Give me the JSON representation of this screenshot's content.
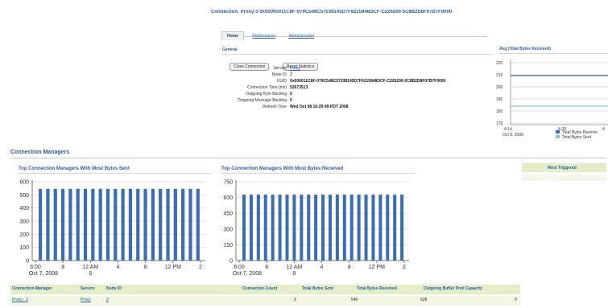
{
  "header": {
    "connection_title": "Connection: Proxy:3 0x00000011C8F-079C5d8C57038145D7F6215848DCF-C226200-5C8B2D8F07B7F0000"
  },
  "tabs": [
    {
      "label": "Home"
    },
    {
      "label": "Performance"
    },
    {
      "label": "Administration"
    }
  ],
  "general": {
    "section_title": "General",
    "close_button": "Close Connection",
    "reset_button": "Reset Statistics",
    "fields": [
      {
        "label": "Service",
        "value": "Proxy"
      },
      {
        "label": "Node ID",
        "value": "2"
      },
      {
        "label": "UUID",
        "value": "0x000011C8F-079C5d8C57038145D7F6215848DCF-C226200-5C8B2D8F07B7F0000"
      },
      {
        "label": "Connection Time (ms)",
        "value": "52673513"
      },
      {
        "label": "Outgoing Byte Backlog",
        "value": "0"
      },
      {
        "label": "Outgoing Message Backlog",
        "value": "0"
      },
      {
        "label": "Refresh Time",
        "value": "Wed Oct 08 16:29:49 PDT 2008"
      }
    ]
  },
  "avg_chart": {
    "title": "Avg (Total Bytes Received)",
    "y_ticks": [
      "220",
      "210",
      "200",
      "190",
      "180",
      "170"
    ],
    "x_ticks": [
      "4:14",
      "4:20",
      "4:"
    ],
    "x_sub": "Oct 8, 2008",
    "legend": [
      "Total Bytes Receive",
      "Total Bytes Sent"
    ]
  },
  "colors": {
    "series_blue": "#3b6db4",
    "series_teal": "#7fc6d6",
    "header_green": "#e3eec9",
    "link_blue": "#2c5aa0"
  },
  "connection_managers": {
    "section_title": "Connection Managers",
    "side_header": "Most Triggered"
  },
  "chart_data": [
    {
      "type": "bar",
      "title": "Top Connection Managers With Most Bytes Sent",
      "y_ticks": [
        "600",
        "500",
        "400",
        "300",
        "200",
        "100",
        "0"
      ],
      "x_tick_labels": [
        "6:00",
        "8",
        "12 AM",
        "4",
        "8",
        "12 PM",
        "2"
      ],
      "x_sub_labels": [
        "Oct 7, 2008",
        "",
        "8",
        "",
        "",
        "",
        ""
      ],
      "ylim": [
        0,
        600
      ],
      "values": [
        546,
        546,
        546,
        546,
        546,
        546,
        546,
        546,
        546,
        546,
        546,
        546,
        546,
        546,
        546,
        546,
        546,
        546,
        546,
        546,
        546,
        546
      ]
    },
    {
      "type": "bar",
      "title": "Top Connection Managers With Most Bytes Received",
      "y_ticks": [
        "750",
        "600",
        "450",
        "300",
        "150",
        "0"
      ],
      "x_tick_labels": [
        "6:00",
        "8",
        "12 AM",
        "4",
        "8",
        "12 PM",
        "2"
      ],
      "x_sub_labels": [
        "Oct 7, 2008",
        "",
        "8",
        "",
        "",
        "",
        ""
      ],
      "ylim": [
        0,
        750
      ],
      "values": [
        628,
        628,
        628,
        628,
        628,
        628,
        628,
        628,
        628,
        628,
        628,
        628,
        628,
        628,
        628,
        628,
        628,
        628,
        628,
        628,
        628,
        628,
        628
      ]
    }
  ],
  "table": {
    "headers": [
      "Connection Manager",
      "Service",
      "Node ID",
      "Connection Count",
      "Total Bytes Sent",
      "Total Bytes Received",
      "Outgoing Buffer Pool Capacity"
    ],
    "rows": [
      [
        "Proxy : 3",
        "Proxy",
        "3",
        "3",
        "546",
        "628",
        "0"
      ]
    ]
  }
}
